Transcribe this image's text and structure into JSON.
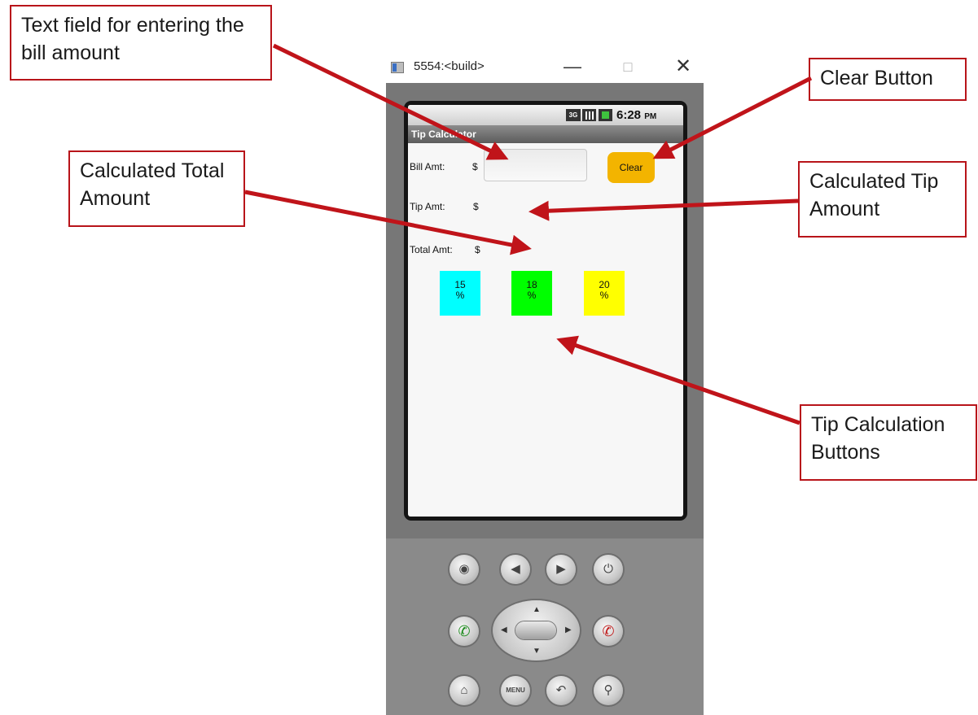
{
  "window": {
    "title": "5554:<build>",
    "minimize_glyph": "—",
    "maximize_glyph": "□",
    "close_glyph": "✕"
  },
  "status_bar": {
    "network": "3G",
    "time": "6:28",
    "ampm": "PM"
  },
  "app": {
    "title": "Tip Calculator",
    "bill_label": "Bill Amt:",
    "bill_currency": "$",
    "bill_value": "",
    "clear_label": "Clear",
    "tip_label": "Tip Amt:",
    "tip_currency": "$",
    "tip_value": "",
    "total_label": "Total Amt:",
    "total_currency": "$",
    "total_value": "",
    "tip_buttons": [
      {
        "value": "15",
        "unit": "%",
        "color": "#00ffff"
      },
      {
        "value": "18",
        "unit": "%",
        "color": "#00ff00"
      },
      {
        "value": "20",
        "unit": "%",
        "color": "#ffff00"
      }
    ]
  },
  "hardware_keys": {
    "menu_label": "MENU",
    "icons": [
      "camera-icon",
      "volume-down-icon",
      "volume-up-icon",
      "power-icon",
      "call-icon",
      "dpad",
      "end-call-icon",
      "home-icon",
      "menu-icon",
      "back-icon",
      "search-icon"
    ]
  },
  "callouts": {
    "bill_field": "Text field for entering the bill amount",
    "clear_button": "Clear Button",
    "total_amount": "Calculated Total Amount",
    "tip_amount": "Calculated Tip Amount",
    "tip_buttons": "Tip Calculation Buttons"
  },
  "colors": {
    "callout_border": "#b8141a",
    "arrow": "#c0141a",
    "clear_button": "#f3b400"
  }
}
